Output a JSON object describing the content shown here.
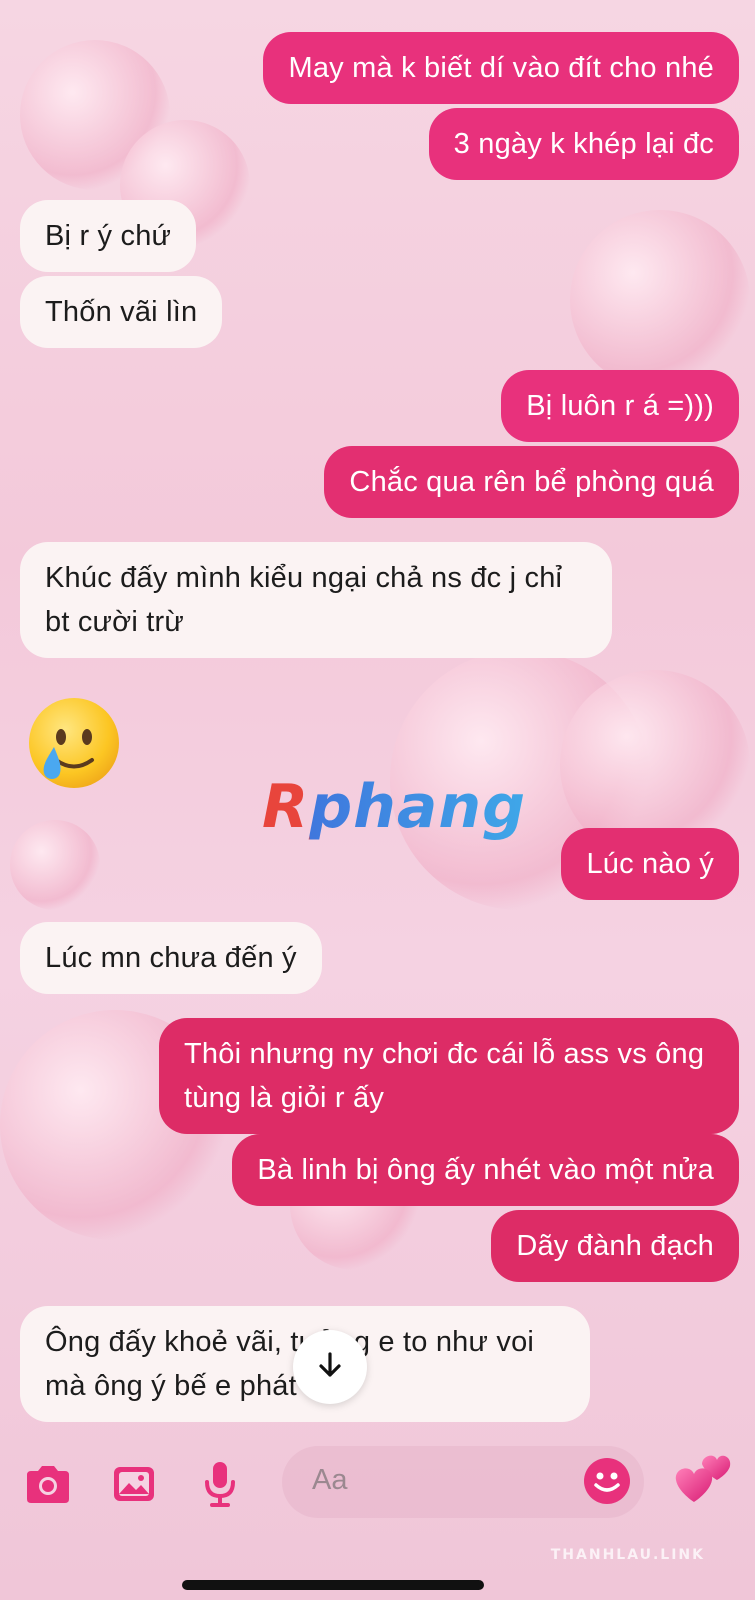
{
  "messages": [
    {
      "side": "sent",
      "text": "May mà k biết dí vào đít cho nhé"
    },
    {
      "side": "sent",
      "text": "3 ngày k khép lại đc"
    },
    {
      "side": "received",
      "text": "Bị r ý chứ"
    },
    {
      "side": "received",
      "text": "Thốn vãi lìn"
    },
    {
      "side": "sent",
      "text": "Bị luôn r á =)))"
    },
    {
      "side": "sent",
      "text": "Chắc qua rên bể phòng quá"
    },
    {
      "side": "received",
      "text": "Khúc đấy mình kiểu ngại chả ns đc j chỉ bt cười trừ"
    },
    {
      "side": "received",
      "emoji": "crying-smile-emoji"
    },
    {
      "side": "sent",
      "text": "Lúc nào ý"
    },
    {
      "side": "received",
      "text": "Lúc mn chưa đến ý"
    },
    {
      "side": "sent",
      "text": "Thôi nhưng ny chơi đc cái lỗ ass vs ông tùng là giỏi r ấy"
    },
    {
      "side": "sent",
      "text": "Bà linh bị ông ấy nhét vào một nửa"
    },
    {
      "side": "sent",
      "text": "Dãy đành đạch"
    },
    {
      "side": "received",
      "text": "Ông đấy khoẻ vãi, tưởng e to như voi mà ông ý bế e phát một"
    }
  ],
  "watermark": "Rphang",
  "composer": {
    "placeholder": "Aa",
    "icons": [
      "camera-icon",
      "gallery-icon",
      "microphone-icon",
      "emoji-icon",
      "hearts-icon"
    ]
  },
  "scroll_button_icon": "arrow-down-icon",
  "credit": "THANHLAU.LINK",
  "colors": {
    "sent_bubble": "#e8317c",
    "received_bubble": "#fbf3f3",
    "accent": "#e8317c",
    "background": "#f5d2e2"
  }
}
